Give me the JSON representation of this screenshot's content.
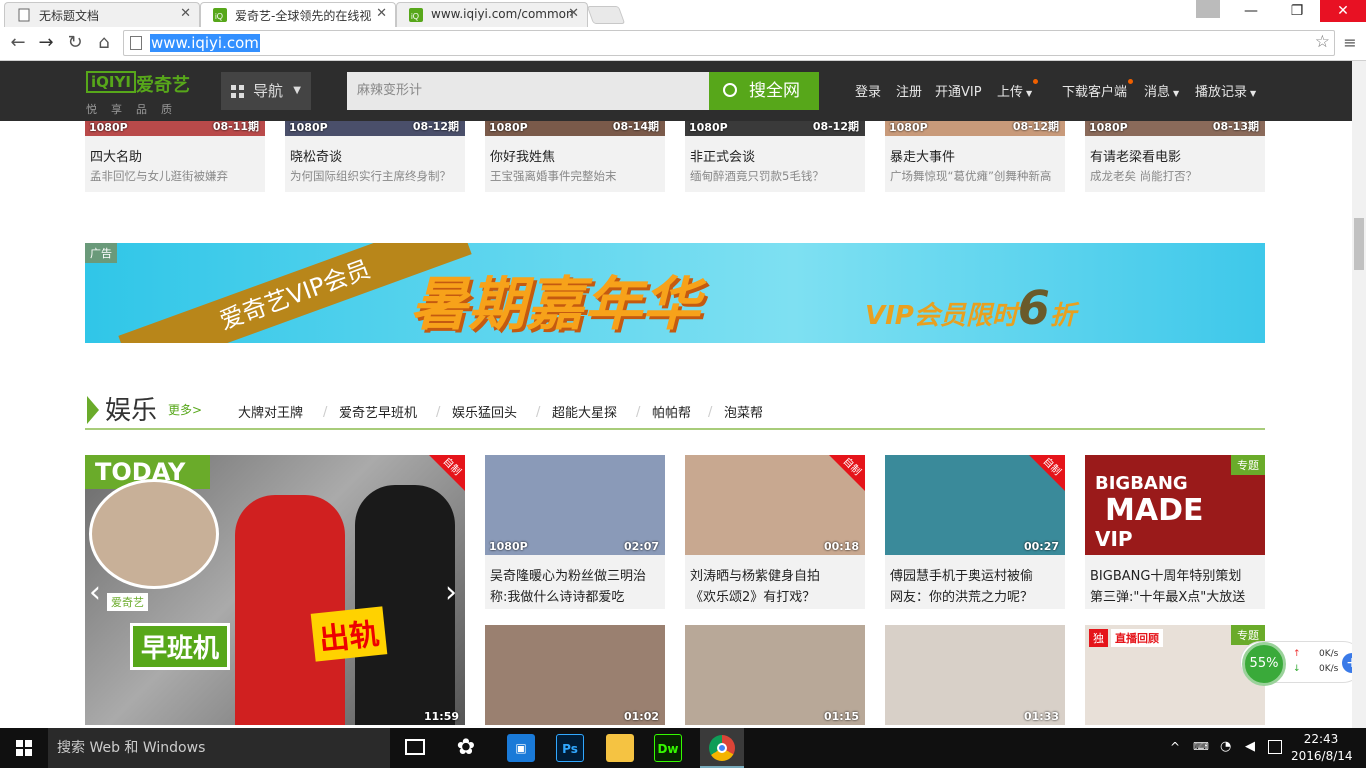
{
  "browser": {
    "tabs": [
      {
        "label": "无标题文档",
        "active": false
      },
      {
        "label": "爱奇艺-全球领先的在线视",
        "active": true
      },
      {
        "label": "www.iqiyi.com/common",
        "active": false
      }
    ],
    "url": "www.iqiyi.com",
    "window_buttons": [
      "—",
      "❐",
      "✕"
    ]
  },
  "header": {
    "logo_text": "iQIYI",
    "logo_cn": "爱奇艺",
    "slogan": "悦享品质",
    "nav_label": "导航",
    "search_placeholder": "麻辣变形计",
    "search_button": "搜全网",
    "links": [
      "登录",
      "注册",
      "开通VIP",
      "上传",
      "下载客户端",
      "消息",
      "播放记录"
    ]
  },
  "top_row": [
    {
      "quality": "1080P",
      "ep": "08-11期",
      "title": "四大名助",
      "sub": "孟非回忆与女儿逛街被嫌弃",
      "color": "#b94a4a"
    },
    {
      "quality": "1080P",
      "ep": "08-12期",
      "title": "晓松奇谈",
      "sub": "为何国际组织实行主席终身制？",
      "color": "#4a4f6a"
    },
    {
      "quality": "1080P",
      "ep": "08-14期",
      "title": "你好我姓焦",
      "sub": "王宝强离婚事件完整始末",
      "color": "#7a5a4a"
    },
    {
      "quality": "1080P",
      "ep": "08-12期",
      "title": "非正式会谈",
      "sub": "缅甸醉酒竟只罚款5毛钱？",
      "color": "#3a3a3a"
    },
    {
      "quality": "1080P",
      "ep": "08-12期",
      "title": "暴走大事件",
      "sub": "广场舞惊现“葛优瘫”创舞种新高",
      "color": "#c89a7a"
    },
    {
      "quality": "1080P",
      "ep": "08-13期",
      "title": "有请老梁看电影",
      "sub": "成龙老矣 尚能打否？",
      "color": "#8a6a5a"
    }
  ],
  "ad": {
    "tag": "广告",
    "ribbon": "爱奇艺VIP会员",
    "title": "暑期嘉年华",
    "offer_prefix": "VIP会员限时",
    "offer_num": "6",
    "offer_suffix": "折"
  },
  "section": {
    "title": "娱乐",
    "more": "更多>",
    "tabs": [
      "大牌对王牌",
      "爱奇艺早班机",
      "娱乐猛回头",
      "超能大星探",
      "帕帕帮",
      "泡菜帮"
    ]
  },
  "feature": {
    "today": "TODAY",
    "show": "早班机",
    "brand": "爱奇艺",
    "headline": "出轨",
    "corner": "自制",
    "duration": "11:59",
    "prev": "‹",
    "next": "›"
  },
  "grid": [
    {
      "quality": "1080P",
      "duration": "02:07",
      "line1": "吴奇隆暖心为粉丝做三明治",
      "line2": "称:我做什么诗诗都爱吃",
      "corner": "",
      "tag": "",
      "color": "#8a9ab8"
    },
    {
      "quality": "",
      "duration": "00:18",
      "line1": "刘涛晒与杨紫健身自拍",
      "line2": "《欢乐颂2》有打戏？",
      "corner": "自制",
      "tag": "",
      "color": "#c8a890"
    },
    {
      "quality": "",
      "duration": "00:27",
      "line1": "傅园慧手机于奥运村被偷",
      "line2": "网友：你的洪荒之力呢？",
      "corner": "自制",
      "tag": "",
      "color": "#3a8a9a"
    },
    {
      "quality": "",
      "duration": "",
      "line1": "BIGBANG十周年特别策划",
      "line2": "第三弹:\"十年最X点\"大放送",
      "corner": "",
      "tag": "专题",
      "color": "#9a1a1a",
      "art1": "BIGBANG",
      "art2": "MADE",
      "art3": "VIP"
    },
    {
      "quality": "",
      "duration": "01:02",
      "line1": "",
      "line2": "",
      "corner": "",
      "tag": "",
      "color": "#9a8070"
    },
    {
      "quality": "",
      "duration": "01:15",
      "line1": "",
      "line2": "",
      "corner": "",
      "tag": "",
      "color": "#b8a898"
    },
    {
      "quality": "",
      "duration": "01:33",
      "line1": "",
      "line2": "",
      "corner": "",
      "tag": "",
      "color": "#d8d0c8"
    },
    {
      "quality": "",
      "duration": "",
      "line1": "",
      "line2": "",
      "corner": "",
      "tag": "专题",
      "color": "#e8e0d8",
      "badge": "独",
      "badge2": "直播回顾"
    }
  ],
  "net_widget": {
    "percent": "55%",
    "up": "0K/s",
    "down": "0K/s"
  },
  "taskbar": {
    "search": "搜索 Web 和 Windows",
    "apps": [
      "Ps",
      "Dw"
    ],
    "time": "22:43",
    "date": "2016/8/14"
  }
}
